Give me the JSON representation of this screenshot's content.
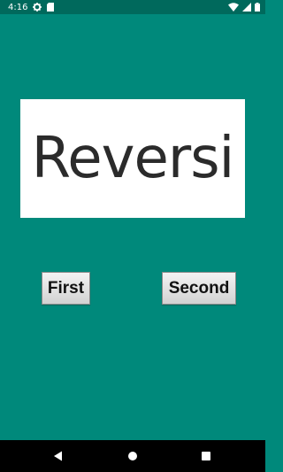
{
  "status_bar": {
    "time": "4:16",
    "icons": [
      "gear-icon",
      "sd-card-icon",
      "wifi-icon",
      "signal-icon",
      "battery-icon"
    ]
  },
  "title": "Reversi",
  "buttons": {
    "first": "First",
    "second": "Second"
  },
  "nav_bar": {
    "icons": [
      "back-icon",
      "home-icon",
      "recents-icon"
    ]
  },
  "colors": {
    "background": "#00897b",
    "status_bar": "#00695c",
    "nav_bar": "#000000"
  }
}
